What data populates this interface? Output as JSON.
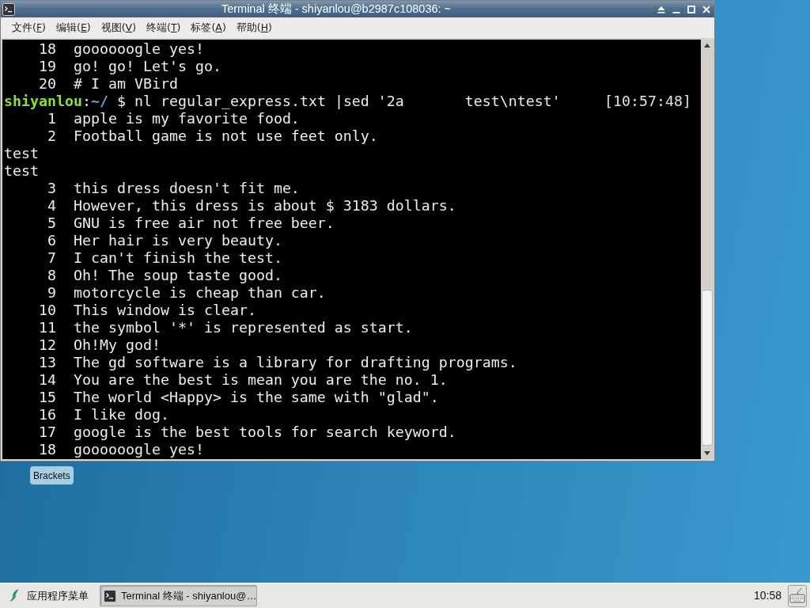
{
  "window": {
    "title": "Terminal 终端 - shiyanlou@b2987c108036: ~"
  },
  "menu": [
    "文件(F)",
    "编辑(E)",
    "视图(V)",
    "终端(T)",
    "标签(A)",
    "帮助(H)"
  ],
  "terminal": {
    "lines": [
      {
        "kind": "output",
        "number": "18",
        "text": "goooooogle yes!"
      },
      {
        "kind": "output",
        "number": "19",
        "text": "go! go! Let's go."
      },
      {
        "kind": "output",
        "number": "20",
        "text": "# I am VBird"
      },
      {
        "kind": "prompt",
        "user": "shiyanlou",
        "separator": ":",
        "path": "~/",
        "symbol": "$",
        "command": "nl regular_express.txt |sed '2a       test\\ntest'",
        "time": "[10:57:48]"
      },
      {
        "kind": "output",
        "number": "1",
        "text": "apple is my favorite food."
      },
      {
        "kind": "output",
        "number": "2",
        "text": "Football game is not use feet only."
      },
      {
        "kind": "plain",
        "text": "test"
      },
      {
        "kind": "plain",
        "text": "test"
      },
      {
        "kind": "output",
        "number": "3",
        "text": "this dress doesn't fit me."
      },
      {
        "kind": "output",
        "number": "4",
        "text": "However, this dress is about $ 3183 dollars."
      },
      {
        "kind": "output",
        "number": "5",
        "text": "GNU is free air not free beer."
      },
      {
        "kind": "output",
        "number": "6",
        "text": "Her hair is very beauty."
      },
      {
        "kind": "output",
        "number": "7",
        "text": "I can't finish the test."
      },
      {
        "kind": "output",
        "number": "8",
        "text": "Oh! The soup taste good."
      },
      {
        "kind": "output",
        "number": "9",
        "text": "motorcycle is cheap than car."
      },
      {
        "kind": "output",
        "number": "10",
        "text": "This window is clear."
      },
      {
        "kind": "output",
        "number": "11",
        "text": "the symbol '*' is represented as start."
      },
      {
        "kind": "output",
        "number": "12",
        "text": "Oh!My god!"
      },
      {
        "kind": "output",
        "number": "13",
        "text": "The gd software is a library for drafting programs."
      },
      {
        "kind": "output",
        "number": "14",
        "text": "You are the best is mean you are the no. 1."
      },
      {
        "kind": "output",
        "number": "15",
        "text": "The world <Happy> is the same with \"glad\"."
      },
      {
        "kind": "output",
        "number": "16",
        "text": "I like dog."
      },
      {
        "kind": "output",
        "number": "17",
        "text": "google is the best tools for search keyword."
      },
      {
        "kind": "output",
        "number": "18",
        "text": "goooooogle yes!"
      }
    ]
  },
  "desktop": {
    "icons": [
      {
        "label": "Brackets"
      }
    ]
  },
  "taskbar": {
    "app_menu": "应用程序菜单",
    "tasks": [
      {
        "label": "Terminal 终端 - shiyanlou@…",
        "selected": true
      }
    ],
    "clock": "10:58"
  }
}
